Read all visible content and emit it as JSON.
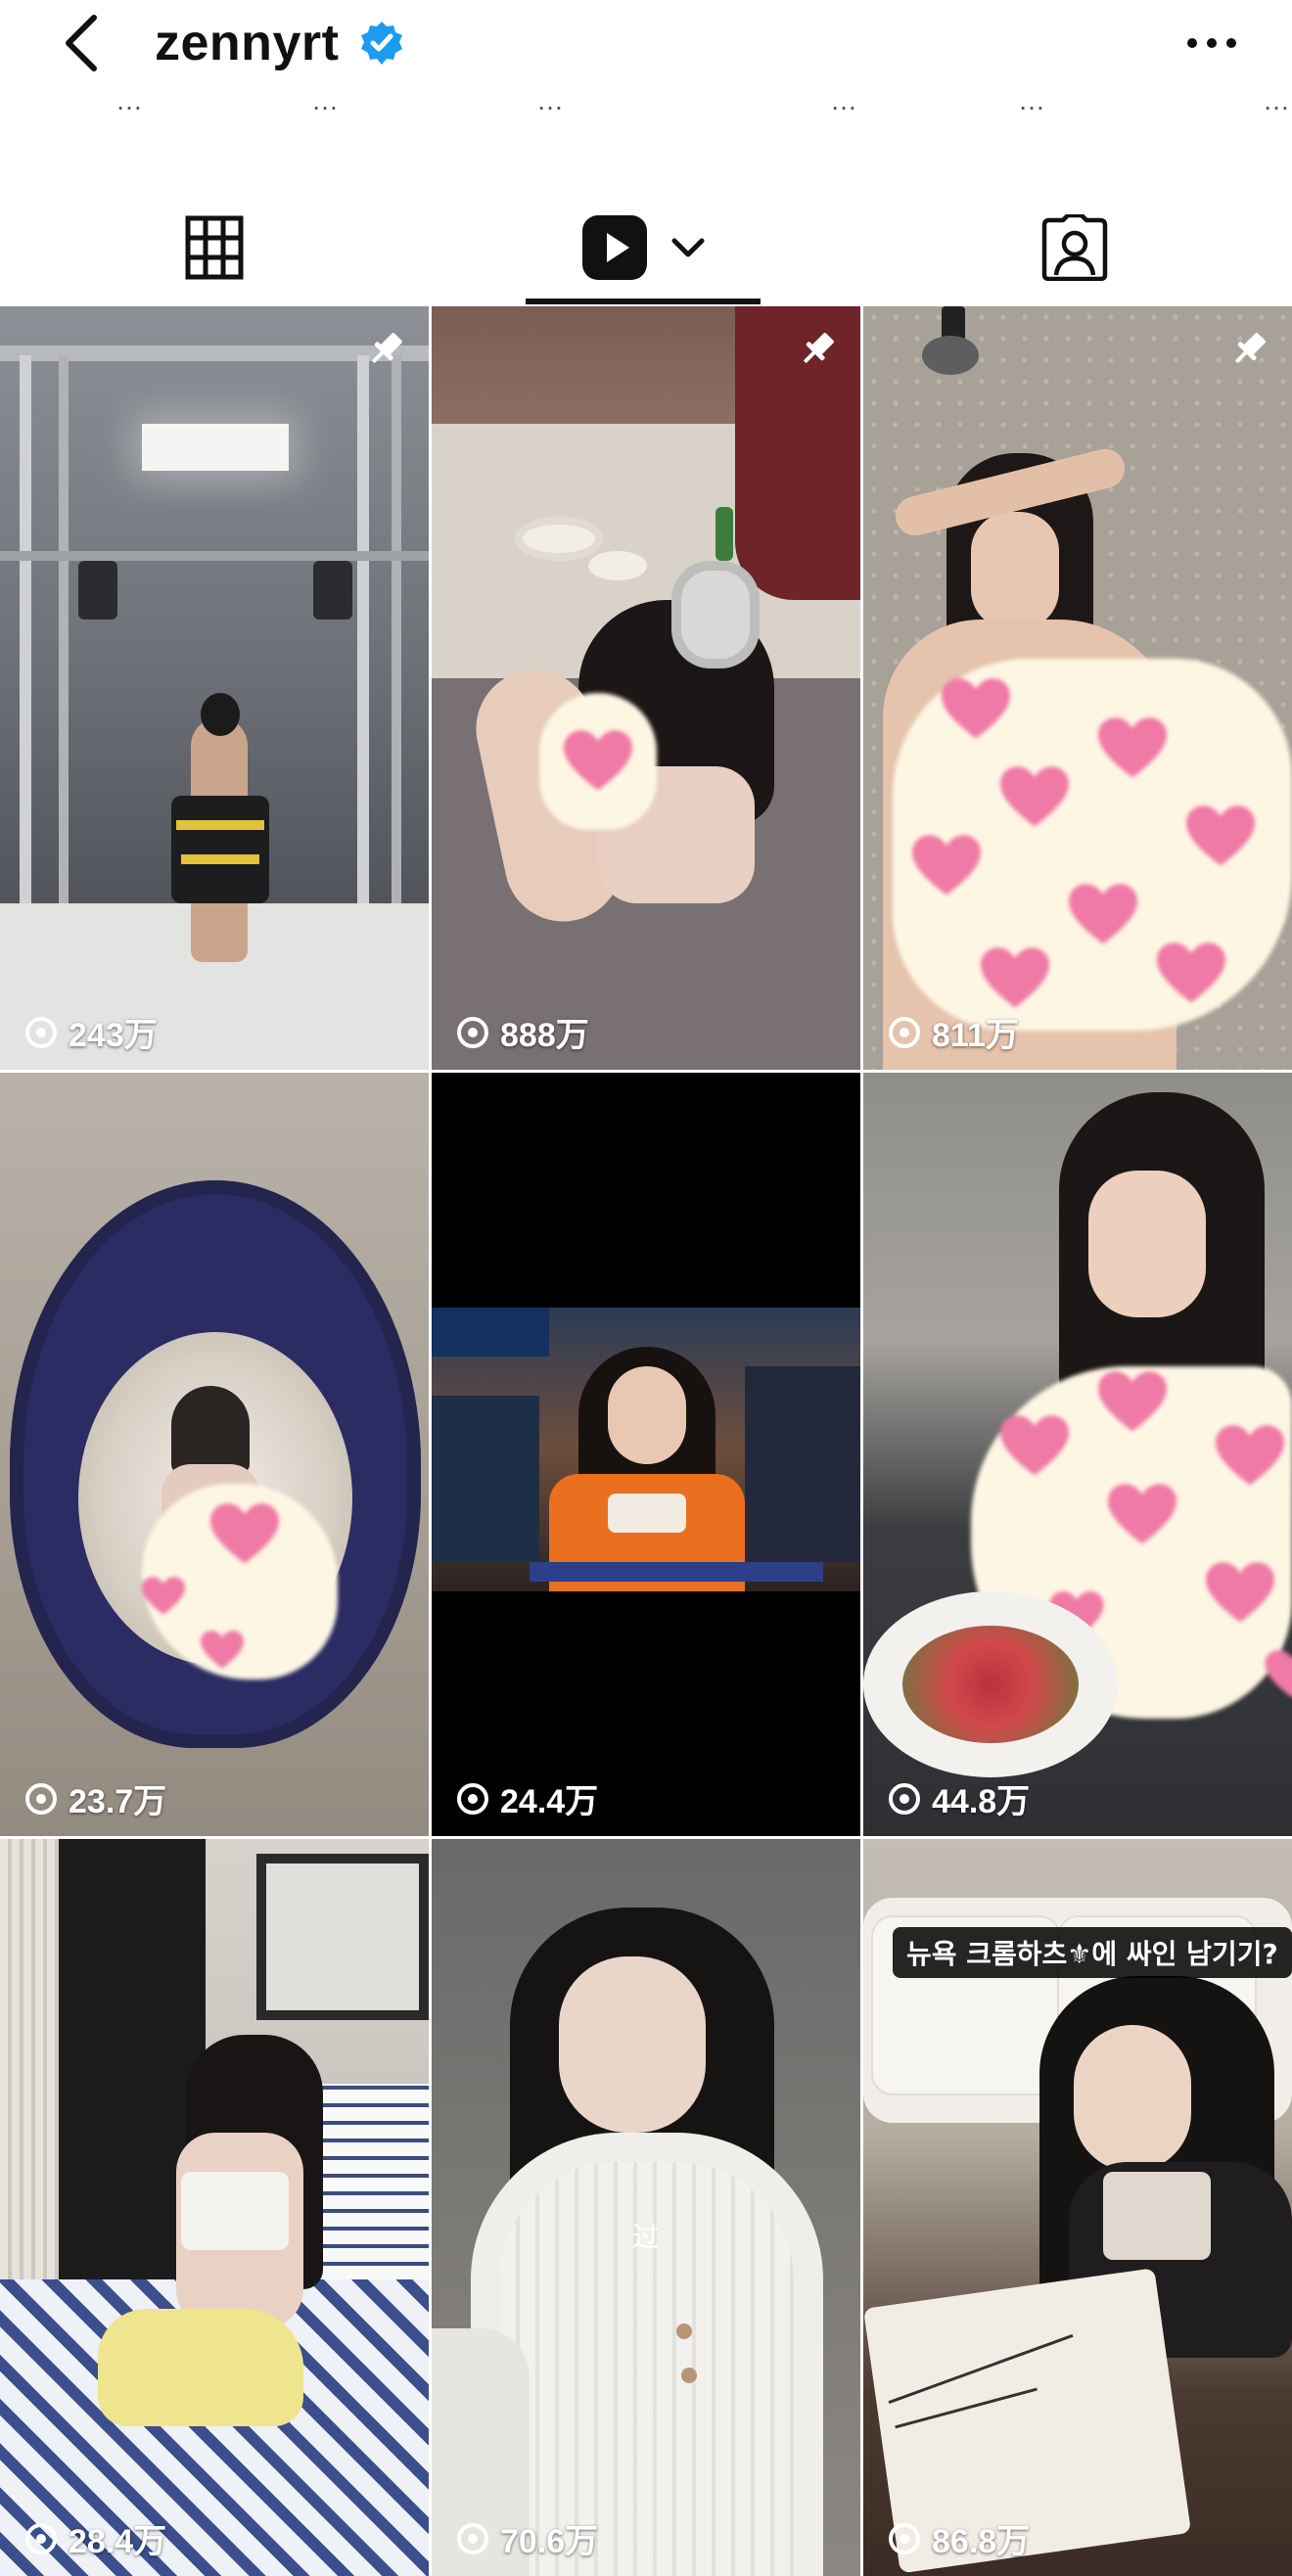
{
  "header": {
    "username": "zennyrt",
    "back_icon": "chevron-left-icon",
    "verified_icon": "verified-badge-icon",
    "more_icon": "more-horizontal-icon"
  },
  "highlights": [
    "…",
    "…",
    "…",
    "…",
    "…",
    "…"
  ],
  "tabs": [
    {
      "name": "grid",
      "icon": "grid-icon"
    },
    {
      "name": "reels",
      "icon": "reels-icon",
      "active": true
    },
    {
      "name": "tagged",
      "icon": "tagged-icon"
    }
  ],
  "posts": [
    {
      "views": "243万",
      "pinned": true
    },
    {
      "views": "888万",
      "pinned": true
    },
    {
      "views": "811万",
      "pinned": true
    },
    {
      "views": "23.7万",
      "pinned": false
    },
    {
      "views": "24.4万",
      "pinned": false
    },
    {
      "views": "44.8万",
      "pinned": false
    },
    {
      "views": "28.4万",
      "pinned": false
    },
    {
      "views": "70.6万",
      "pinned": false,
      "center_text": "过"
    },
    {
      "views": "86.8万",
      "pinned": false,
      "caption": "뉴욕 크롬하츠⚜에 싸인 남기기?"
    }
  ],
  "colors": {
    "accent": "#1d9bf0",
    "text": "#111111",
    "sticker": "#fdf6e3",
    "heart": "#f07aa6"
  }
}
